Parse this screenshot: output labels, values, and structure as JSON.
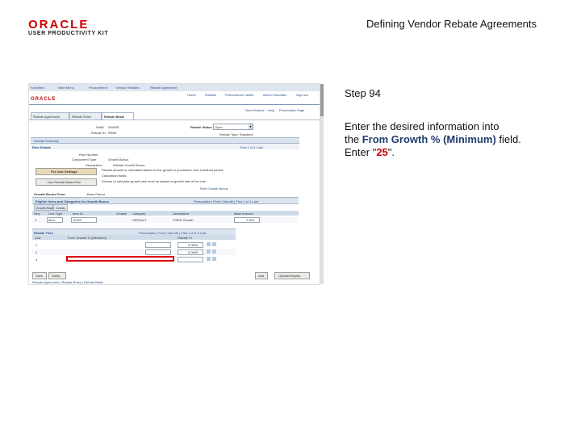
{
  "header": {
    "logo_text": "ORACLE",
    "logo_subtitle": "USER PRODUCTIVITY KIT",
    "doc_title": "Defining Vendor Rebate Agreements"
  },
  "instructions": {
    "step": "Step 94",
    "line1": "Enter the desired information into",
    "line2_prefix": "the ",
    "field_name": "From Growth % (Minimum)",
    "line2_suffix": " field.",
    "enter_prefix": "Enter \"",
    "value": "25",
    "enter_suffix": "\"."
  },
  "colors": {
    "brand_red": "#cc0000",
    "highlight_red": "#e00000",
    "field_name_blue": "#1f3b6f"
  },
  "app": {
    "nav_links": [
      "Favorites",
      "Main Menu",
      "Procurement",
      "Vendor Rebates",
      "Rebate Agreement"
    ],
    "header_links": [
      "Home",
      "Worklist",
      "Performance Health",
      "Add to Favorites",
      "Sign out"
    ],
    "logo": "ORACLE",
    "page_links": [
      "New Window",
      "Help",
      "Personalize Page"
    ],
    "tabs": [
      "Rebate Agreement",
      "Rebate Rules",
      "Rebate Basis"
    ],
    "setid": {
      "label": "SetID",
      "value": "SHARE"
    },
    "rebate_id": {
      "label": "Rebate ID",
      "value": "REB0"
    },
    "rebate_status": {
      "label": "Rebate Status",
      "value": "Open"
    },
    "rebate_type": {
      "label": "Rebate Type",
      "value": "Rebate Type: Standard"
    },
    "rebate_summary_label": "Rebate Summary",
    "rule_details_label": "Rule Details",
    "rule_nav": "First 1 of 1 Last",
    "rule_number": {
      "label": "Rule Number"
    },
    "component_type": {
      "label": "Component Type",
      "value": "Growth Bonus"
    },
    "description": {
      "label": "Description",
      "value": "Rebate Growth Bonus"
    },
    "rule_text": "Rebate amount is calculated based on the growth in purchases over a defined period.",
    "rule_text_2": "Calculation basis.",
    "rule_text_3": "Volume to calculate growth rate must be based on growth rate of the rule.",
    "btn_pct_calc": "Pct Calc Settings",
    "btn_retro": "Use Rebate Basis Rule",
    "show_bonus_link": "Rule Growth Bonus",
    "growth_bonus_from_label": "Growth Bonus From",
    "base_period_label": "Base Period",
    "eligible_grid_title": "Eligible Items and Categories for Growth Bonus",
    "eligible_grid_nav": "Personalize | Find | View All | First 1 of 1 Last",
    "inner_tabs": [
      "Growth Basis",
      "Details"
    ],
    "eligible_cols": [
      "Seq",
      "Line Type",
      "Item ID",
      "Growth",
      "Category",
      "Description",
      "Base Amount"
    ],
    "eligible_row": [
      "1",
      "Item",
      "10003",
      "",
      "DEFAULT",
      "FIXED Growth",
      "1.000"
    ],
    "rebate_tiers_title": "Rebate Tiers",
    "rebate_tiers_nav": "Personalize | Find | View All | First 1-3 of 3 Last",
    "tier_cols": [
      "Line",
      "From Growth % (Minimum)",
      "Rebate %"
    ],
    "tier_rows": [
      {
        "line": "1",
        "from": "",
        "rebate": "0.0000"
      },
      {
        "line": "2",
        "from": "",
        "rebate": "0.0000"
      },
      {
        "line": "3",
        "from": "",
        "rebate": ""
      }
    ],
    "save_label": "Save",
    "notify_label": "Notify",
    "add_label": "Add",
    "update_label": "Update/Display",
    "footer_links": "Rebate Agreement | Rebate Rules | Rebate Basis"
  }
}
